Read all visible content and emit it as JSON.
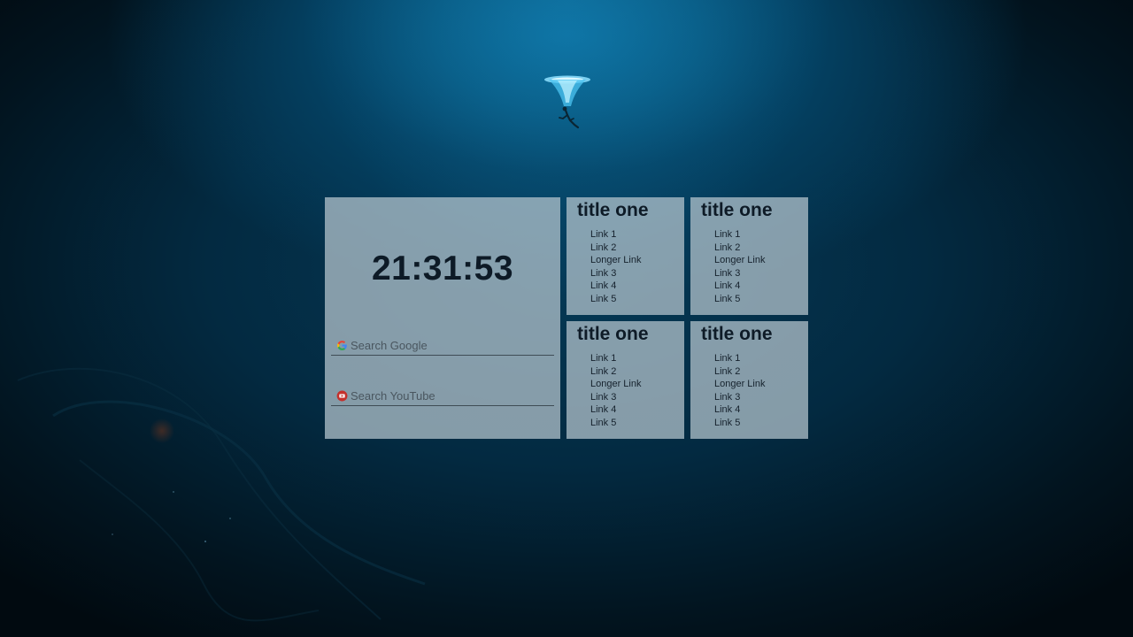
{
  "clock": {
    "time": "21:31:53"
  },
  "search": {
    "google_placeholder": "Search Google",
    "youtube_placeholder": "Search YouTube"
  },
  "icons": {
    "google": "google-g-icon",
    "youtube": "youtube-play-icon"
  },
  "colors": {
    "panel_bg": "#b8c8d0",
    "text": "#0d1a26",
    "youtube_red": "#c4302b"
  },
  "link_panels": [
    {
      "title": "title one",
      "links": [
        "Link 1",
        "Link 2",
        "Longer Link",
        "Link 3",
        "Link 4",
        "Link 5"
      ]
    },
    {
      "title": "title one",
      "links": [
        "Link 1",
        "Link 2",
        "Longer Link",
        "Link 3",
        "Link 4",
        "Link 5"
      ]
    },
    {
      "title": "title one",
      "links": [
        "Link 1",
        "Link 2",
        "Longer Link",
        "Link 3",
        "Link 4",
        "Link 5"
      ]
    },
    {
      "title": "title one",
      "links": [
        "Link 1",
        "Link 2",
        "Longer Link",
        "Link 3",
        "Link 4",
        "Link 5"
      ]
    }
  ]
}
